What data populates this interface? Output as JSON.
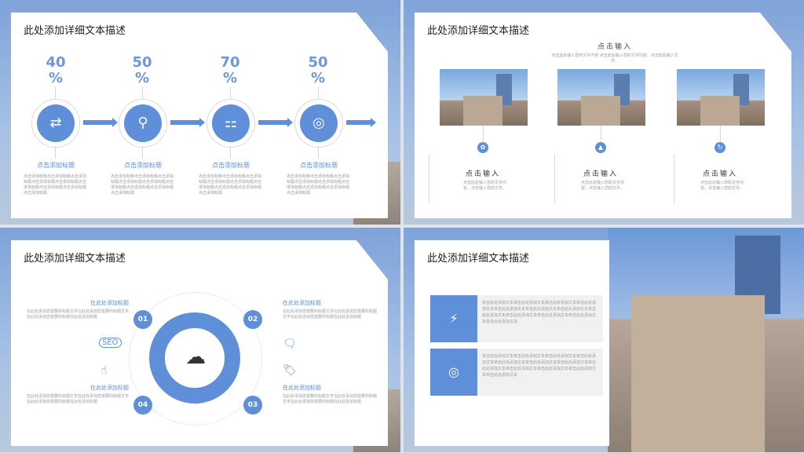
{
  "slides": [
    {
      "title": "此处添加详细文本描述",
      "steps": [
        {
          "value": "40",
          "unit": "%",
          "heading": "点击添加标题",
          "text": "点击添加标题点击添加标题点击添加标题点击添加标题点击添加标题点击添加标题点击添加标题点击添加标题 点击添加标题",
          "icon": "flowchart-icon"
        },
        {
          "value": "50",
          "unit": "%",
          "heading": "点击添加标题",
          "text": "点击添加标题点击添加标题点击添加标题点击添加标题点击添加标题点击添加标题点击添加标题点击添加标题 点击添加标题",
          "icon": "person-icon"
        },
        {
          "value": "70",
          "unit": "%",
          "heading": "点击添加标题",
          "text": "点击添加标题点击添加标题点击添加标题点击添加标题点击添加标题点击添加标题点击添加标题点击添加标题 点击添加标题",
          "icon": "network-icon"
        },
        {
          "value": "50",
          "unit": "%",
          "heading": "点击添加标题",
          "text": "点击添加标题点击添加标题点击添加标题点击添加标题点击添加标题点击添加标题点击添加标题点击添加标题 点击添加标题",
          "icon": "target-person-icon"
        }
      ]
    },
    {
      "title": "此处添加详细文本描述",
      "heading": "点击输入",
      "subtext": "点击此处输入您的文字内容 点击此处输入您的文字内容，点击此处输入文字。",
      "items": [
        {
          "label": "点击输入",
          "text": "点击此处输入您的文字内容，点击输入您的文字。"
        },
        {
          "label": "点击输入",
          "text": "点击此处输入您的文字内容，点击输入您的文字。"
        },
        {
          "label": "点击输入",
          "text": "点击此处输入您的文字内容，点击输入您的文字。"
        }
      ]
    },
    {
      "title": "此处添加详细文本描述",
      "left_top": {
        "heading": "在此处添加标题",
        "text": "在此处添加您需要的标题文字在此处添加您需要的标题文字在此处添加您需要的标题在此处添加标题"
      },
      "left_bottom": {
        "heading": "在此处添加标题",
        "text": "在此处添加您需要的标题文字在此处添加您需要的标题文字在此处添加您需要的标题在此处添加标题"
      },
      "right_top": {
        "heading": "在此处添加标题",
        "text": "在此处添加您需要的标题文字在此处添加您需要的标题文字在此处添加您需要的标题在此处添加标题"
      },
      "right_bottom": {
        "heading": "在此处添加标题",
        "text": "在此处添加您需要的标题文字在此处添加您需要的标题文字在此处添加您需要的标题在此处添加标题"
      },
      "numbers": [
        "01",
        "02",
        "03",
        "04"
      ],
      "seo": "SEO"
    },
    {
      "title": "此处添加详细文本描述",
      "panels": [
        {
          "text": "单击此处添加文本单击此处添加文本单击此处添加文本单击此处添加文本单击此处添加文本单击此处添加文本单击此处添加文本单击此处添加文本单击此处添加文本单击此处添加文本单击此处添加文本单击此处添加文本",
          "icon": "lightning-icon"
        },
        {
          "text": "单击此处添加文本单击此处添加文本单击此处添加文本单击此处添加文本单击此处添加文本单击此处添加文本单击此处添加文本单击此处添加文本单击此处添加文本单击此处添加文本单击此处添加文本单击此处添加文本",
          "icon": "target-icon"
        }
      ]
    }
  ]
}
